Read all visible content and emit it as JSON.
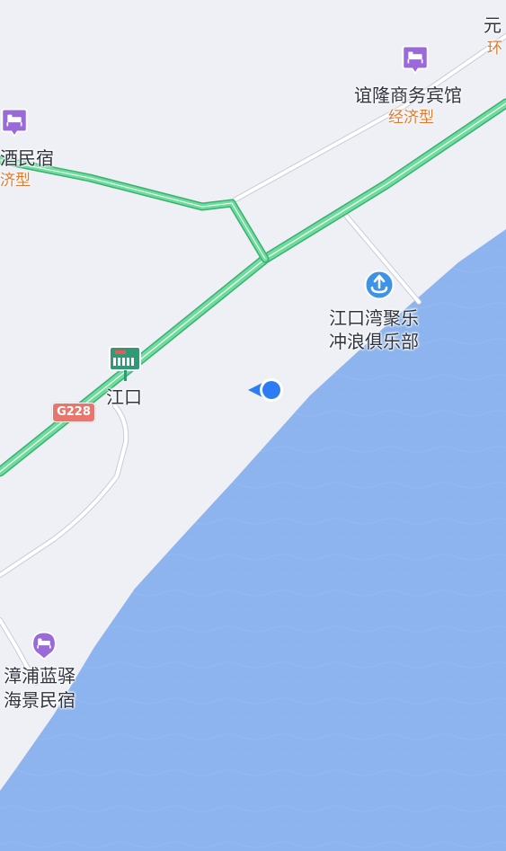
{
  "map": {
    "colors": {
      "land": "#eef0f6",
      "water": "#8db4ee",
      "highway": "#4fd08a",
      "road": "#ffffff",
      "road_edge": "#c8ccd6",
      "hotel_icon": "#9a6ad8",
      "surf_icon": "#3f93e6",
      "station_icon": "#2f9a74",
      "location_dot": "#2d7cf6",
      "label_text": "#2f3440",
      "category_text": "#e07a2e",
      "shield_bg": "#e8766e"
    },
    "pois": {
      "yilong_hotel": {
        "name": "谊隆商务宾馆",
        "category": "经济型",
        "icon": "hotel-icon"
      },
      "left_hotel": {
        "name": "酒民宿",
        "category": "济型",
        "icon": "hotel-icon"
      },
      "top_right": {
        "name": "元",
        "category": "环",
        "icon": "none"
      },
      "surf_club": {
        "name_line1": "江口湾聚乐",
        "name_line2": "冲浪俱乐部",
        "icon": "surf-icon"
      },
      "jiangkou_station": {
        "name": "江口",
        "icon": "bus-station-icon"
      },
      "zhangpu_inn": {
        "name_line1": "漳浦蓝驿",
        "name_line2": "海景民宿",
        "icon": "hotel-icon"
      }
    },
    "road_shield": {
      "label": "G228"
    },
    "current_location": {
      "icon": "location-dot-icon",
      "heading": "west"
    }
  }
}
